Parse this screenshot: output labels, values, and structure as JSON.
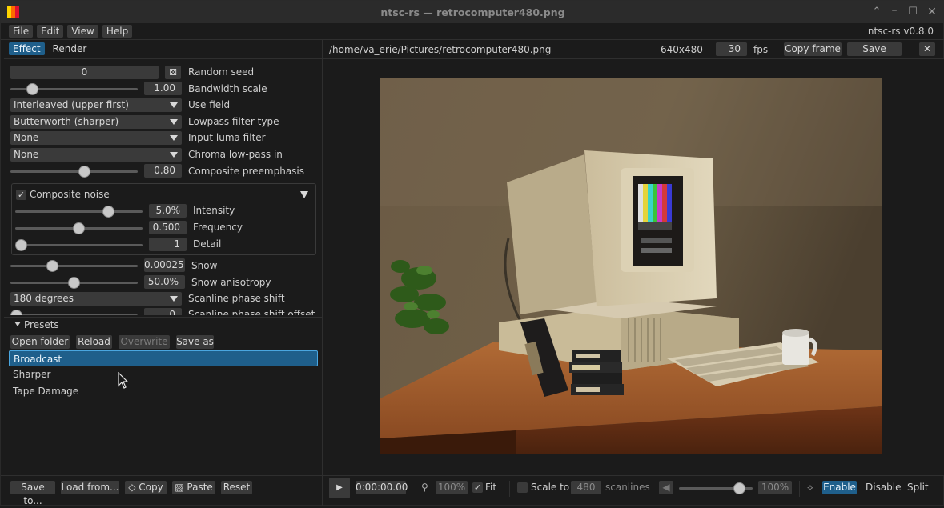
{
  "window": {
    "title": "ntsc-rs — retrocomputer480.png",
    "version": "ntsc-rs v0.8.0"
  },
  "menu": [
    "File",
    "Edit",
    "View",
    "Help"
  ],
  "tabs": {
    "effect": "Effect",
    "render": "Render"
  },
  "effect": {
    "random_seed": {
      "value": "0",
      "label": "Random seed"
    },
    "bandwidth_scale": {
      "value": "1.00",
      "label": "Bandwidth scale",
      "level": 0.14
    },
    "use_field": {
      "value": "Interleaved (upper first)",
      "label": "Use field"
    },
    "lowpass_filter_type": {
      "value": "Butterworth (sharper)",
      "label": "Lowpass filter type"
    },
    "input_luma_filter": {
      "value": "None",
      "label": "Input luma filter"
    },
    "chroma_lowpass_in": {
      "value": "None",
      "label": "Chroma low-pass in"
    },
    "composite_preemphasis": {
      "value": "0.80",
      "label": "Composite preemphasis",
      "level": 0.59
    },
    "composite_noise": {
      "label": "Composite noise",
      "checked": true,
      "intensity": {
        "value": "5.0%",
        "label": "Intensity",
        "level": 0.76
      },
      "frequency": {
        "value": "0.500",
        "label": "Frequency",
        "level": 0.5
      },
      "detail": {
        "value": "1",
        "label": "Detail",
        "level": 0.0
      }
    },
    "snow": {
      "value": "0.00025",
      "label": "Snow",
      "level": 0.31
    },
    "snow_anisotropy": {
      "value": "50.0%",
      "label": "Snow anisotropy",
      "level": 0.5
    },
    "scanline_phase_shift": {
      "value": "180 degrees",
      "label": "Scanline phase shift"
    },
    "scanline_phase_shift_offset": {
      "value": "0",
      "label": "Scanline phase shift offset"
    }
  },
  "presets": {
    "header": "Presets",
    "buttons": {
      "open_folder": "Open folder",
      "reload": "Reload",
      "overwrite": "Overwrite",
      "save_as": "Save as"
    },
    "items": [
      "Broadcast",
      "Sharper",
      "Tape Damage"
    ],
    "selected": "Broadcast"
  },
  "image_bar": {
    "path": "/home/va_erie/Pictures/retrocomputer480.png",
    "resolution": "640x480",
    "fps_value": "30",
    "fps_label": "fps",
    "copy_frame": "Copy frame",
    "save_frame": "Save frame"
  },
  "footer": {
    "save_to": "Save to...",
    "load_from": "Load from...",
    "copy": "Copy",
    "paste": "Paste",
    "reset": "Reset",
    "timecode": "0:00:00.00",
    "zoom": "100%",
    "fit": "Fit",
    "scale_to": "Scale to",
    "scale_value": "480",
    "scanlines": "scanlines",
    "volume": "100%",
    "volume_level": 0.88,
    "enable": "Enable",
    "disable": "Disable",
    "split": "Split"
  },
  "colors": {
    "accent": "#1f5f8b",
    "accent_border": "#4aa6e0"
  }
}
